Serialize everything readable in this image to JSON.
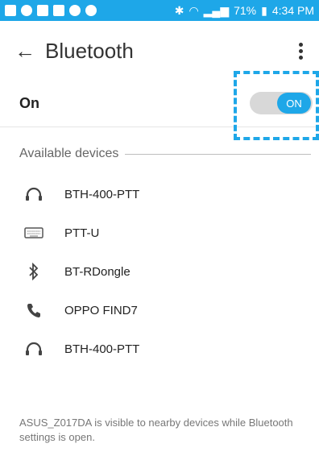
{
  "status_bar": {
    "battery": "71%",
    "time": "4:34 PM"
  },
  "app_bar": {
    "title": "Bluetooth"
  },
  "toggle": {
    "label": "On",
    "state_text": "ON"
  },
  "section": {
    "title": "Available devices"
  },
  "devices": [
    {
      "name": "BTH-400-PTT",
      "icon": "headphones-icon"
    },
    {
      "name": "PTT-U",
      "icon": "keyboard-icon"
    },
    {
      "name": "BT-RDongle",
      "icon": "bluetooth-icon"
    },
    {
      "name": "OPPO FIND7",
      "icon": "phone-icon"
    },
    {
      "name": "BTH-400-PTT",
      "icon": "headphones-icon"
    }
  ],
  "footer": {
    "text": "ASUS_Z017DA is visible to nearby devices while Bluetooth settings is open."
  },
  "colors": {
    "accent": "#1ea7e8"
  }
}
